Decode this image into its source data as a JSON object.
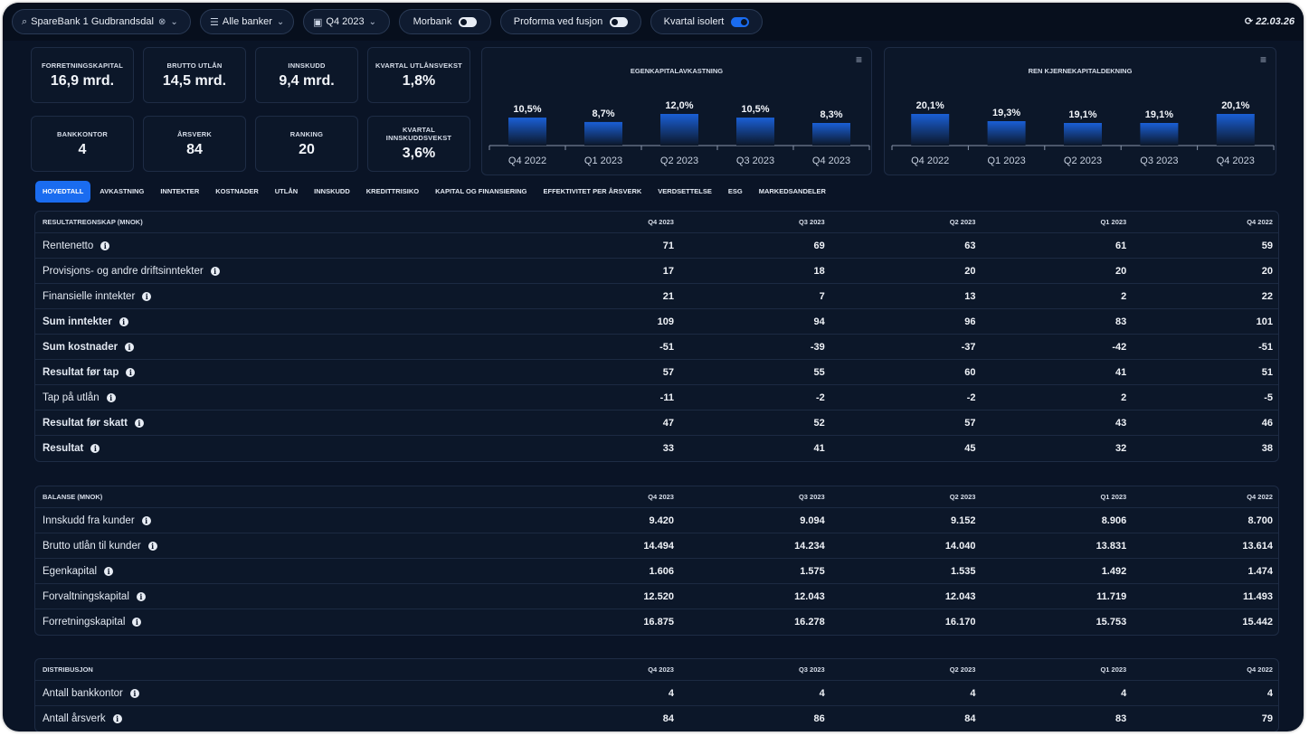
{
  "topbar": {
    "bank_select": "SpareBank 1 Gudbrandsdal",
    "bank_filter": "Alle banker",
    "period": "Q4 2023",
    "morbank_label": "Morbank",
    "proforma_label": "Proforma ved fusjon",
    "kvartal_label": "Kvartal isolert",
    "date": "22.03.26"
  },
  "kpis": [
    {
      "label": "FORRETNINGSKAPITAL",
      "value": "16,9 mrd."
    },
    {
      "label": "BRUTTO UTLÅN",
      "value": "14,5 mrd."
    },
    {
      "label": "INNSKUDD",
      "value": "9,4 mrd."
    },
    {
      "label": "KVARTAL UTLÅNSVEKST",
      "value": "1,8%"
    },
    {
      "label": "BANKKONTOR",
      "value": "4"
    },
    {
      "label": "ÅRSVERK",
      "value": "84"
    },
    {
      "label": "RANKING",
      "value": "20"
    },
    {
      "label": "KVARTAL INNSKUDDSVEKST",
      "value": "3,6%"
    }
  ],
  "chart_data": [
    {
      "type": "bar",
      "title": "EGENKAPITALAVKASTNING",
      "categories": [
        "Q4 2022",
        "Q1 2023",
        "Q2 2023",
        "Q3 2023",
        "Q4 2023"
      ],
      "values": [
        10.5,
        8.7,
        12.0,
        10.5,
        8.3
      ],
      "labels": [
        "10,5%",
        "8,7%",
        "12,0%",
        "10,5%",
        "8,3%"
      ],
      "color": "#1a5fd6"
    },
    {
      "type": "bar",
      "title": "REN KJERNEKAPITALDEKNING",
      "categories": [
        "Q4 2022",
        "Q1 2023",
        "Q2 2023",
        "Q3 2023",
        "Q4 2023"
      ],
      "values": [
        20.1,
        19.3,
        19.1,
        19.1,
        20.1
      ],
      "labels": [
        "20,1%",
        "19,3%",
        "19,1%",
        "19,1%",
        "20,1%"
      ],
      "color": "#1a5fd6"
    }
  ],
  "tabs": [
    "HOVEDTALL",
    "AVKASTNING",
    "INNTEKTER",
    "KOSTNADER",
    "UTLÅN",
    "INNSKUDD",
    "KREDITTRISIKO",
    "KAPITAL OG FINANSIERING",
    "EFFEKTIVITET PER ÅRSVERK",
    "VERDSETTELSE",
    "ESG",
    "MARKEDSANDELER"
  ],
  "tables": {
    "resultat": {
      "header": "RESULTATREGNSKAP (MNOK)",
      "columns": [
        "Q4 2023",
        "Q3 2023",
        "Q2 2023",
        "Q1 2023",
        "Q4 2022"
      ],
      "rows": [
        {
          "label": "Rentenetto",
          "bold": false,
          "values": [
            "71",
            "69",
            "63",
            "61",
            "59"
          ]
        },
        {
          "label": "Provisjons- og andre driftsinntekter",
          "bold": false,
          "values": [
            "17",
            "18",
            "20",
            "20",
            "20"
          ]
        },
        {
          "label": "Finansielle inntekter",
          "bold": false,
          "values": [
            "21",
            "7",
            "13",
            "2",
            "22"
          ]
        },
        {
          "label": "Sum inntekter",
          "bold": true,
          "values": [
            "109",
            "94",
            "96",
            "83",
            "101"
          ]
        },
        {
          "label": "Sum kostnader",
          "bold": true,
          "values": [
            "-51",
            "-39",
            "-37",
            "-42",
            "-51"
          ]
        },
        {
          "label": "Resultat før tap",
          "bold": true,
          "values": [
            "57",
            "55",
            "60",
            "41",
            "51"
          ]
        },
        {
          "label": "Tap på utlån",
          "bold": false,
          "values": [
            "-11",
            "-2",
            "-2",
            "2",
            "-5"
          ]
        },
        {
          "label": "Resultat før skatt",
          "bold": true,
          "values": [
            "47",
            "52",
            "57",
            "43",
            "46"
          ]
        },
        {
          "label": "Resultat",
          "bold": true,
          "values": [
            "33",
            "41",
            "45",
            "32",
            "38"
          ]
        }
      ]
    },
    "balanse": {
      "header": "BALANSE (MNOK)",
      "columns": [
        "Q4 2023",
        "Q3 2023",
        "Q2 2023",
        "Q1 2023",
        "Q4 2022"
      ],
      "rows": [
        {
          "label": "Innskudd fra kunder",
          "bold": false,
          "values": [
            "9.420",
            "9.094",
            "9.152",
            "8.906",
            "8.700"
          ]
        },
        {
          "label": "Brutto utlån til kunder",
          "bold": false,
          "values": [
            "14.494",
            "14.234",
            "14.040",
            "13.831",
            "13.614"
          ]
        },
        {
          "label": "Egenkapital",
          "bold": false,
          "values": [
            "1.606",
            "1.575",
            "1.535",
            "1.492",
            "1.474"
          ]
        },
        {
          "label": "Forvaltningskapital",
          "bold": false,
          "values": [
            "12.520",
            "12.043",
            "12.043",
            "11.719",
            "11.493"
          ]
        },
        {
          "label": "Forretningskapital",
          "bold": false,
          "values": [
            "16.875",
            "16.278",
            "16.170",
            "15.753",
            "15.442"
          ]
        }
      ]
    },
    "distribusjon": {
      "header": "DISTRIBUSJON",
      "columns": [
        "Q4 2023",
        "Q3 2023",
        "Q2 2023",
        "Q1 2023",
        "Q4 2022"
      ],
      "rows": [
        {
          "label": "Antall bankkontor",
          "bold": false,
          "values": [
            "4",
            "4",
            "4",
            "4",
            "4"
          ]
        },
        {
          "label": "Antall årsverk",
          "bold": false,
          "values": [
            "84",
            "86",
            "84",
            "83",
            "79"
          ]
        }
      ]
    }
  }
}
